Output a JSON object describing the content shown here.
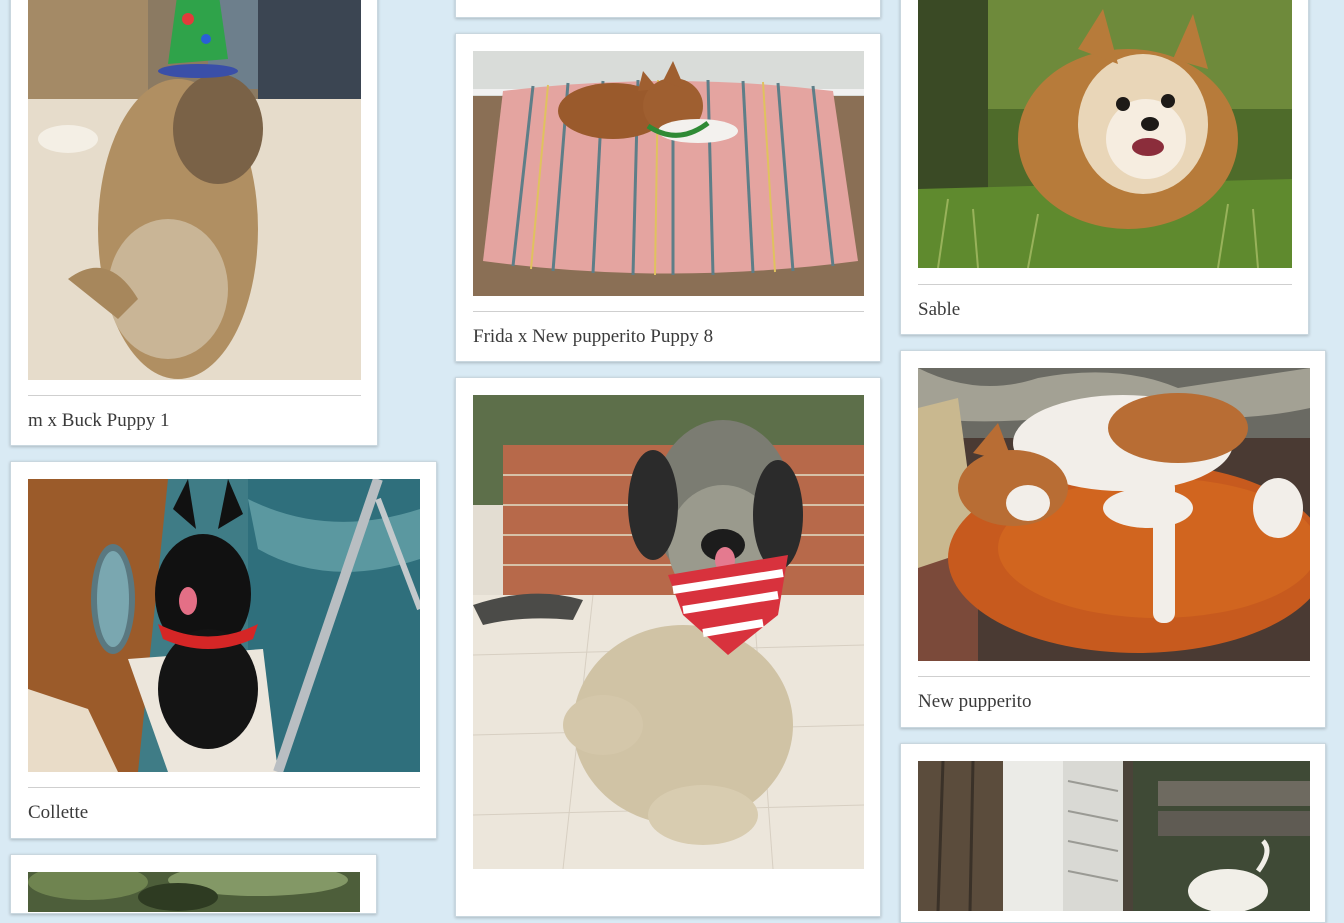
{
  "colors": {
    "background": "#d9eaf4",
    "card": "#ffffff",
    "caption_text": "#3a3a3a"
  },
  "gallery": {
    "cards": [
      {
        "caption": "m x Buck Puppy 1",
        "photo": "dog-in-party-hat-photo"
      },
      {
        "caption": "Collette",
        "photo": "black-dog-on-boat-photo"
      },
      {
        "caption": "",
        "photo": "dog-in-garden-photo"
      },
      {
        "caption": "",
        "photo": "partially-visible-photo"
      },
      {
        "caption": "Frida x New pupperito Puppy 8",
        "photo": "dog-on-striped-bed-photo"
      },
      {
        "caption": "",
        "photo": "shaggy-dog-with-bandana-photo"
      },
      {
        "caption": "Sable",
        "photo": "small-fluffy-dog-in-grass-photo"
      },
      {
        "caption": "New pupperito",
        "photo": "dog-sleeping-on-pillow-photo"
      },
      {
        "caption": "",
        "photo": "dog-on-porch-photo"
      }
    ]
  }
}
